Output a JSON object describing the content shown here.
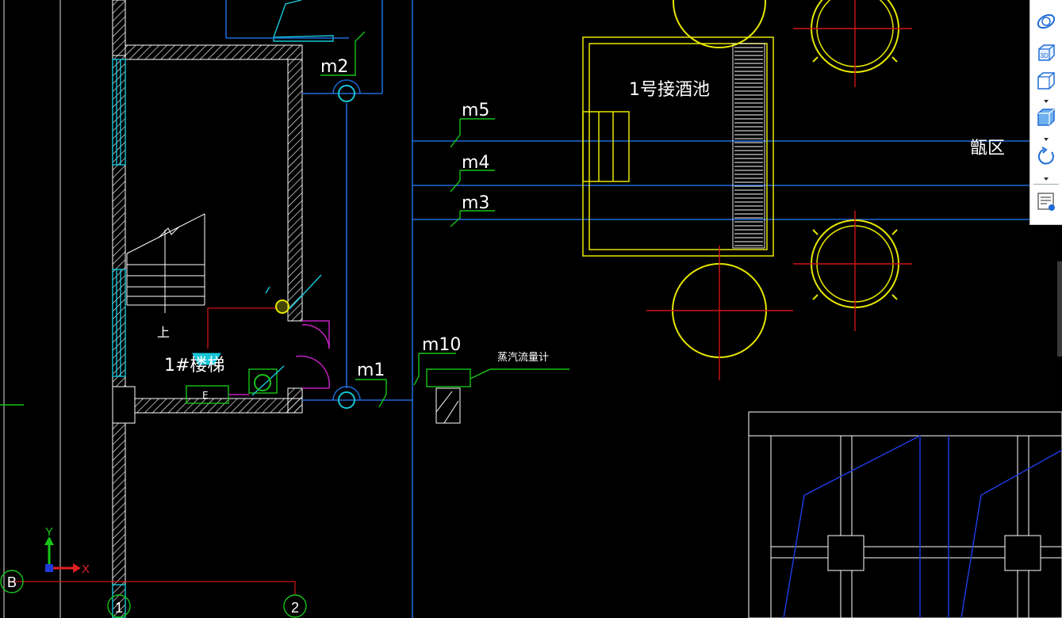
{
  "drawing": {
    "labels": {
      "m1": "m1",
      "m2": "m2",
      "m3": "m3",
      "m4": "m4",
      "m5": "m5",
      "m10": "m10",
      "tank1": "1号接酒池",
      "zone": "甑区",
      "stair_name": "1#楼梯",
      "stair_up": "上",
      "flowmeter": "蒸汽流量计",
      "box_label": "E"
    },
    "axes": {
      "y_label": "Y",
      "x_label": "X"
    },
    "grid_bubbles": [
      "B",
      "1",
      "2"
    ]
  },
  "toolbar": {
    "items": [
      {
        "name": "orbit-icon"
      },
      {
        "name": "3d-view-icon",
        "text": "3D"
      },
      {
        "name": "view-cube-icon"
      },
      {
        "name": "shaded-cube-icon"
      },
      {
        "name": "rotate-icon"
      },
      {
        "name": "properties-panel-icon"
      }
    ]
  },
  "colors": {
    "background": "#000000",
    "wall": "#ffffff",
    "pipe_blue": "#1e6bd6",
    "window_cyan": "#16c6d8",
    "label_green": "#16c416",
    "tank_yellow": "#e6e600",
    "center_red": "#d01515",
    "door_magenta": "#c020c0"
  }
}
